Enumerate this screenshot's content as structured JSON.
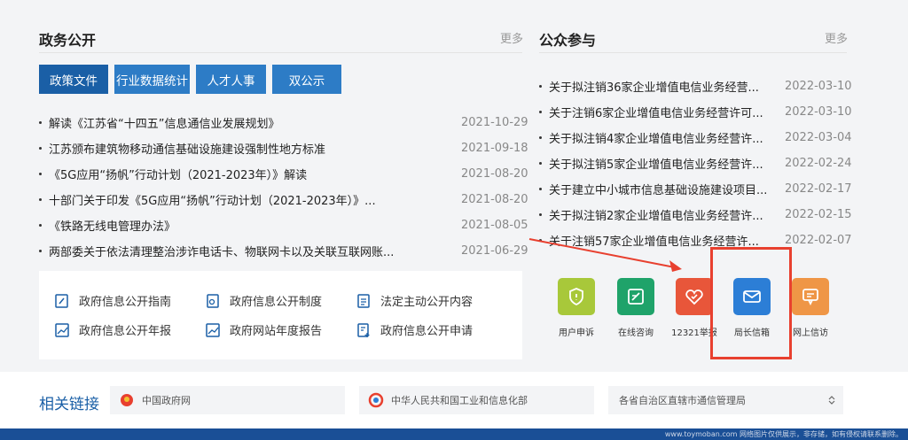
{
  "left": {
    "title": "政务公开",
    "more": "更多",
    "tabs": [
      "政策文件",
      "行业数据统计",
      "人才人事",
      "双公示"
    ],
    "items": [
      {
        "title": "解读《江苏省“十四五”信息通信业发展规划》",
        "date": "2021-10-29"
      },
      {
        "title": "江苏颁布建筑物移动通信基础设施建设强制性地方标准",
        "date": "2021-09-18"
      },
      {
        "title": "《5G应用“扬帆”行动计划（2021-2023年）》解读",
        "date": "2021-08-20"
      },
      {
        "title": "十部门关于印发《5G应用“扬帆”行动计划（2021-2023年）》...",
        "date": "2021-08-20"
      },
      {
        "title": "《铁路无线电管理办法》",
        "date": "2021-08-05"
      },
      {
        "title": "两部委关于依法清理整治涉诈电话卡、物联网卡以及关联互联网账...",
        "date": "2021-06-29"
      }
    ],
    "box": [
      {
        "label": "政府信息公开指南",
        "icon": "pen-doc-icon"
      },
      {
        "label": "政府信息公开制度",
        "icon": "gear-doc-icon"
      },
      {
        "label": "法定主动公开内容",
        "icon": "list-doc-icon"
      },
      {
        "label": "政府信息公开年报",
        "icon": "chart-doc-icon"
      },
      {
        "label": "政府网站年度报告",
        "icon": "chart-doc-icon"
      },
      {
        "label": "政府信息公开申请",
        "icon": "plus-doc-icon"
      }
    ]
  },
  "right": {
    "title": "公众参与",
    "more": "更多",
    "items": [
      {
        "title": "关于拟注销36家企业增值电信业务经营...",
        "date": "2022-03-10"
      },
      {
        "title": "关于注销6家企业增值电信业务经营许可...",
        "date": "2022-03-10"
      },
      {
        "title": "关于拟注销4家企业增值电信业务经营许...",
        "date": "2022-03-04"
      },
      {
        "title": "关于拟注销5家企业增值电信业务经营许...",
        "date": "2022-02-24"
      },
      {
        "title": "关于建立中小城市信息基础设施建设项目...",
        "date": "2022-02-17"
      },
      {
        "title": "关于拟注销2家企业增值电信业务经营许...",
        "date": "2022-02-15"
      },
      {
        "title": "关于注销57家企业增值电信业务经营许...",
        "date": "2022-02-07"
      }
    ],
    "services": [
      {
        "label": "用户申诉",
        "icon": "shield-icon",
        "color": "#a8c83a"
      },
      {
        "label": "在线咨询",
        "icon": "edit-icon",
        "color": "#1fa36a"
      },
      {
        "label": "12321举报",
        "icon": "heart-icon",
        "color": "#e8563a"
      },
      {
        "label": "局长信箱",
        "icon": "mail-icon",
        "color": "#2c7ed6"
      },
      {
        "label": "网上信访",
        "icon": "chat-icon",
        "color": "#ef9646"
      }
    ]
  },
  "links": {
    "title": "相关链接",
    "items": [
      "中国政府网",
      "中华人民共和国工业和信息化部",
      "各省自治区直辖市通信管理局"
    ]
  },
  "watermark": "www.toymoban.com 网络图片仅供展示，非存储，如有侵权请联系删除。"
}
